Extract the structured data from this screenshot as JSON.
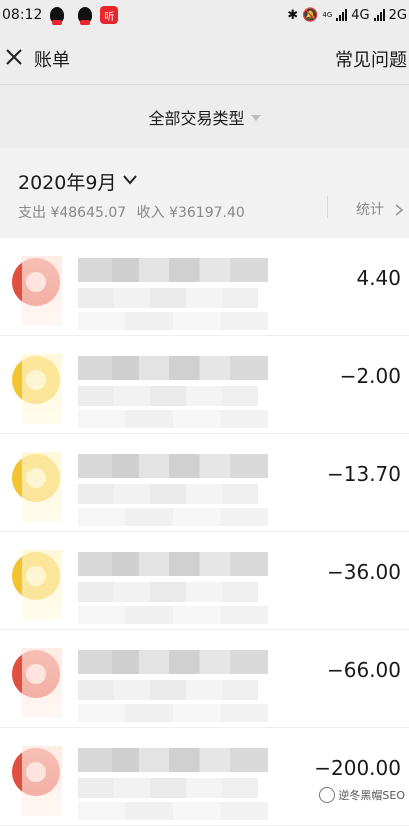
{
  "status_bar": {
    "time": "08:12",
    "net1": "4G",
    "net2": "2G",
    "small_tag": "4G\nHD",
    "app3_label": "听"
  },
  "header": {
    "title": "账单",
    "help": "常见问题"
  },
  "filter": {
    "label": "全部交易类型"
  },
  "summary": {
    "month": "2020年9月",
    "expense": "支出 ¥48645.07",
    "income": "收入 ¥36197.40",
    "stats": "统计"
  },
  "transactions": [
    {
      "amount": "4.40",
      "icon": "red-avatar",
      "color": "#e05040"
    },
    {
      "amount": "−2.00",
      "icon": "yellow-avatar",
      "color": "#f4c430"
    },
    {
      "amount": "−13.70",
      "icon": "yellow-avatar",
      "color": "#f4c430"
    },
    {
      "amount": "−36.00",
      "icon": "yellow-avatar",
      "color": "#f4c430"
    },
    {
      "amount": "−66.00",
      "icon": "red-avatar",
      "color": "#e05040"
    },
    {
      "amount": "−200.00",
      "icon": "red-avatar",
      "color": "#e05040"
    }
  ],
  "watermark": {
    "text": "逆冬黑帽SEO"
  }
}
